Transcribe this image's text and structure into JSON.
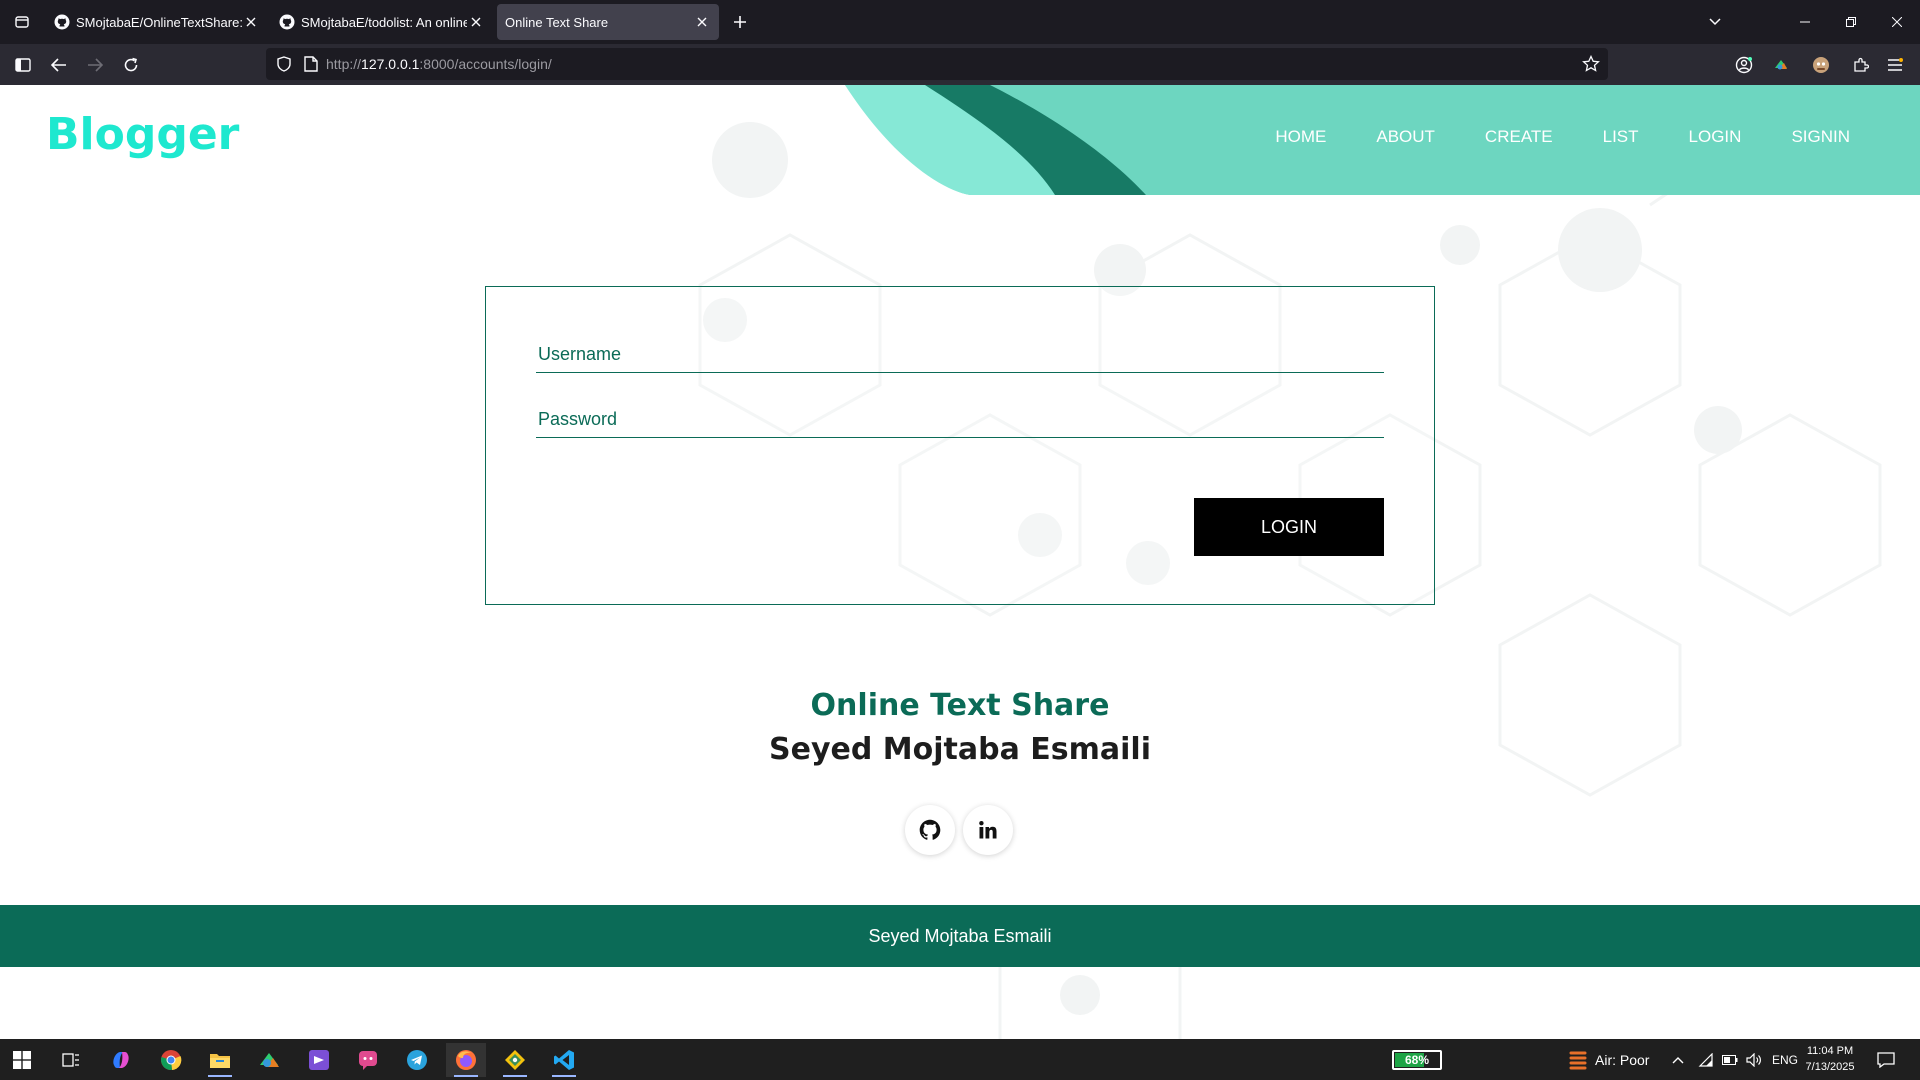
{
  "browser": {
    "tabs": [
      {
        "title": "SMojtabaE/OnlineTextShare: A S",
        "icon": "github-icon",
        "active": false
      },
      {
        "title": "SMojtabaE/todolist: An online T",
        "icon": "github-icon",
        "active": false
      },
      {
        "title": "Online Text Share",
        "icon": "",
        "active": true
      }
    ],
    "url_prefix": "http://",
    "url_host": "127.0.0.1",
    "url_rest": ":8000/accounts/login/"
  },
  "site": {
    "logo": "Blogger",
    "nav": [
      "HOME",
      "ABOUT",
      "CREATE",
      "LIST",
      "LOGIN",
      "SIGNIN"
    ]
  },
  "login_form": {
    "username_placeholder": "Username",
    "password_placeholder": "Password",
    "submit_label": "LOGIN"
  },
  "footer_info": {
    "title": "Online Text Share",
    "author": "Seyed Mojtaba Esmaili",
    "socials": [
      "github-icon",
      "linkedin-icon"
    ],
    "copyright": "Seyed Mojtaba Esmaili"
  },
  "taskbar": {
    "battery_percent": "68%",
    "battery_level": 0.68,
    "weather": "Air: Poor",
    "language": "ENG",
    "time": "11:04 PM",
    "date": "7/13/2025"
  },
  "colors": {
    "brand_teal": "#0b6b57",
    "logo_cyan": "#1ee8cf",
    "header_mint": "#6dd6c0"
  }
}
